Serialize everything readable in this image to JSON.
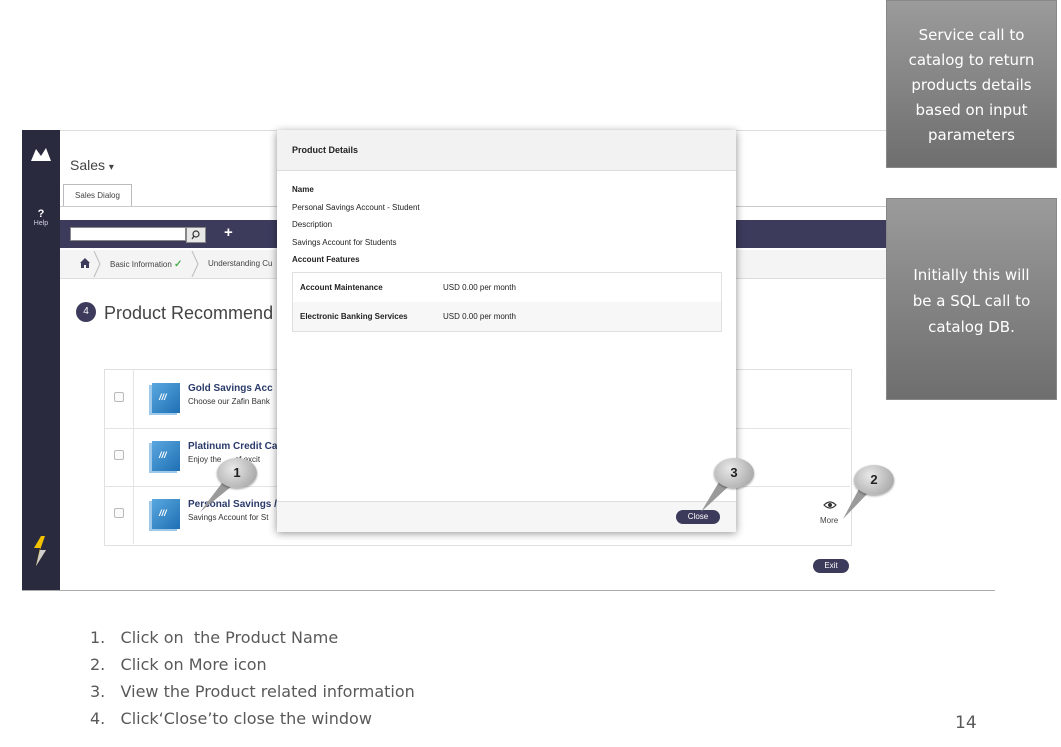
{
  "app": {
    "help_label": "Help",
    "help_glyph": "?",
    "title": "Sales",
    "title_caret": "▾",
    "tab_label": "Sales Dialog",
    "plus_glyph": "+"
  },
  "breadcrumb": {
    "step1": "Basic Information",
    "step1_check": "✓",
    "step2": "Understanding Cu"
  },
  "page": {
    "step_number": "4",
    "heading": "Product Recommend"
  },
  "products": [
    {
      "name": "Gold Savings Acc",
      "description": "Choose our Zafin Bank"
    },
    {
      "name": "Platinum Credit Ca",
      "description": "Enjoy the      of excit"
    },
    {
      "name": "Personal Savings /",
      "description": "Savings Account for St"
    }
  ],
  "product_icon_glyph": "///",
  "actions": {
    "more_label": "More",
    "exit_label": "Exit"
  },
  "modal": {
    "title": "Product Details",
    "name_label": "Name",
    "name_value": "Personal Savings Account - Student",
    "description_label": "Description",
    "description_value": "Savings Account for Students",
    "features_label": "Account Features",
    "features": [
      {
        "name": "Account Maintenance",
        "value": "USD 0.00 per month"
      },
      {
        "name": "Electronic Banking Services",
        "value": "USD 0.00 per month"
      }
    ],
    "close_label": "Close"
  },
  "callouts": [
    "1",
    "2",
    "3"
  ],
  "notes": {
    "note1": [
      "Service call to",
      "catalog to return",
      "products details",
      "based on input",
      "parameters"
    ],
    "note2": [
      "Initially this will",
      "be a SQL call to",
      "catalog DB."
    ]
  },
  "instructions": [
    "1.   Click on  the Product Name",
    "2.   Click on More icon",
    "3.   View the Product related information",
    "4.   Click‘Close’to close the window"
  ],
  "page_number": "14",
  "colors": {
    "rail": "#2a2a3e",
    "toolbar": "#3d3b5c",
    "accent_green": "#4caf50"
  }
}
